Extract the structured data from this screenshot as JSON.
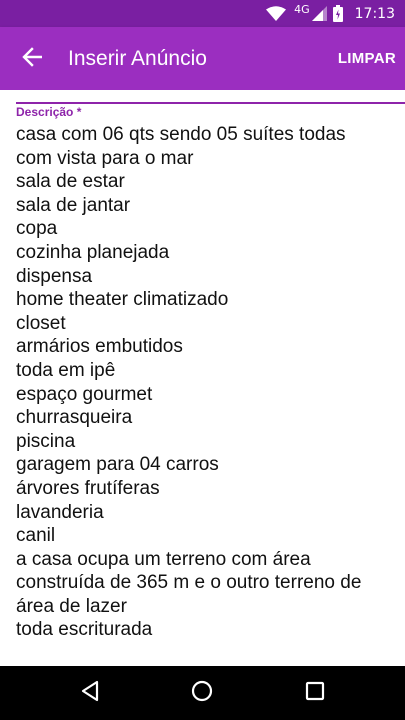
{
  "status_bar": {
    "network_type": "4G",
    "time": "17:13",
    "icons": [
      "wifi-icon",
      "cell-signal-icon",
      "battery-icon"
    ]
  },
  "app_bar": {
    "back_icon": "arrow-back-icon",
    "title": "Inserir Anúncio",
    "clear_label": "LIMPAR"
  },
  "form": {
    "description_label": "Descrição *",
    "description_lines": [
      "casa com 06 qts sendo 05 suítes todas",
      "com vista para o mar",
      "sala de estar",
      "sala de jantar",
      "copa",
      "cozinha planejada",
      "dispensa",
      "home theater climatizado",
      "closet",
      "armários embutidos",
      "toda em ipê",
      "espaço gourmet",
      "churrasqueira",
      "piscina",
      "garagem para 04 carros",
      "árvores frutíferas",
      "lavanderia",
      "canil",
      "a casa ocupa um terreno com área",
      "construída de 365 m e o outro terreno de",
      "área de lazer",
      "toda escriturada"
    ]
  },
  "nav_bar": {
    "icons": [
      "nav-back-icon",
      "nav-home-icon",
      "nav-recents-icon"
    ]
  },
  "colors": {
    "status_bar": "#7a1fa2",
    "app_bar": "#9b2ec0",
    "accent": "#8e24aa",
    "text": "#111111",
    "nav_bar": "#000000"
  }
}
